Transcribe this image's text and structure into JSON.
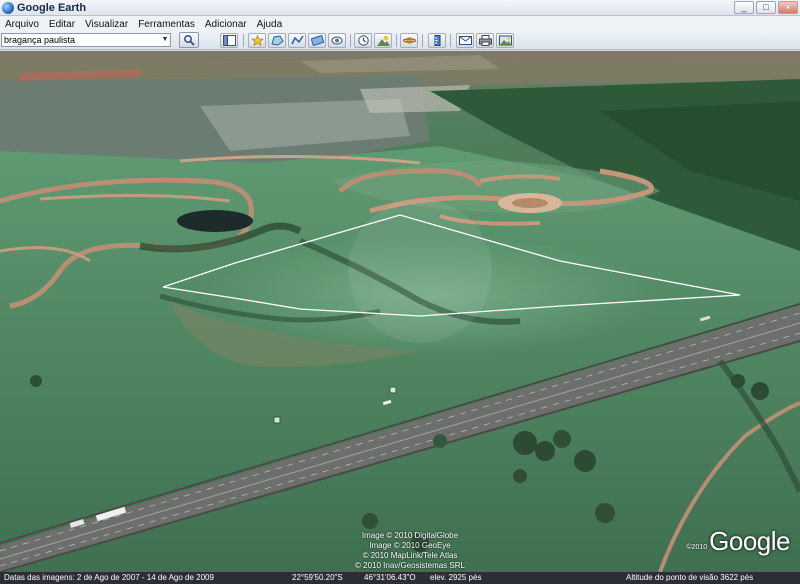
{
  "window": {
    "title": "Google Earth",
    "minimize": "_",
    "maximize": "□",
    "close": "×"
  },
  "menu": {
    "items": [
      "Arquivo",
      "Editar",
      "Visualizar",
      "Ferramentas",
      "Adicionar",
      "Ajuda"
    ]
  },
  "toolbar": {
    "search_value": "bragança paulista",
    "buttons": [
      "search-icon",
      "sidebar-icon",
      "placemark-icon",
      "polygon-icon",
      "path-icon",
      "image-overlay-icon",
      "record-tour-icon",
      "historical-imagery-icon",
      "sun-icon",
      "planets-icon",
      "ruler-icon",
      "email-icon",
      "print-icon",
      "save-image-icon"
    ]
  },
  "map": {
    "attribution": [
      "Image © 2010 DigitalGlobe",
      "Image © 2010 GeoEye",
      "© 2010 MapLink/Tele Atlas",
      "© 2010 Inav/Geosistemas SRL"
    ],
    "logo_copyright": "©2010",
    "logo": "Google"
  },
  "status": {
    "imagery_dates": "Datas das imagens:  2 de Ago de 2007 - 14 de Ago de 2009",
    "latitude": "22°59'50.20\"S",
    "longitude": "46°31'06.43\"O",
    "elevation": "elev.  2925 pés",
    "eye_altitude": "Altitude do ponto de visão    3622 pés"
  },
  "colors": {
    "status_bg": "#2b2f35",
    "field_green": "#4f7d5a",
    "parcel_outline": "#ffffff",
    "dirt_road": "#b98f73"
  }
}
